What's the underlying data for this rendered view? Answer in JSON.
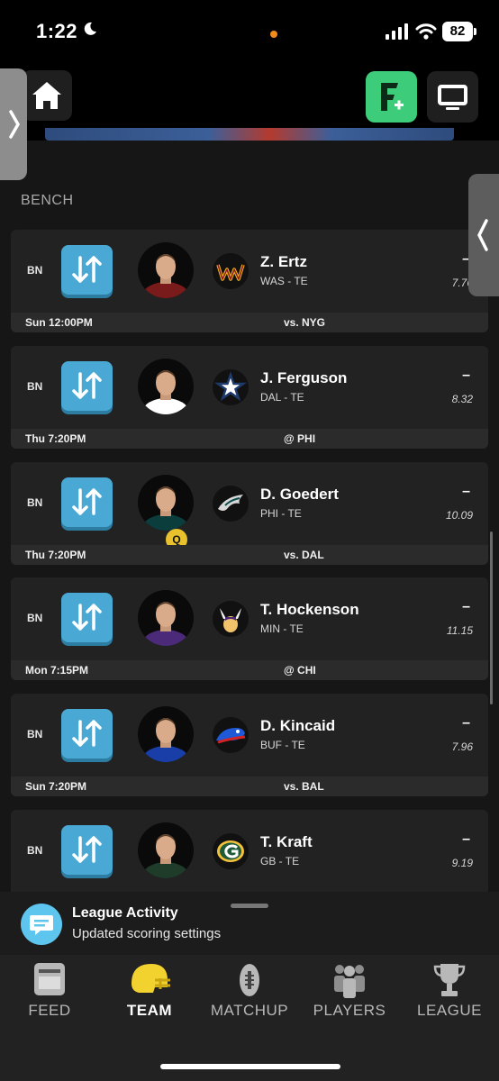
{
  "status": {
    "time": "1:22",
    "battery": "82"
  },
  "header": {
    "home_icon": "home-icon",
    "fantasy_plus_icon": "fantasy-plus-icon",
    "tv_icon": "tv-icon"
  },
  "bench": {
    "title": "BENCH",
    "players": [
      {
        "slot": "BN",
        "name": "Z. Ertz",
        "team_pos": "WAS - TE",
        "points": "–",
        "projection": "7.76",
        "game_time": "Sun 12:00PM",
        "opponent": "vs. NYG",
        "team_color": "#7a1b1b",
        "logo": "commanders-logo"
      },
      {
        "slot": "BN",
        "name": "J. Ferguson",
        "team_pos": "DAL - TE",
        "points": "–",
        "projection": "8.32",
        "game_time": "Thu 7:20PM",
        "opponent": "@ PHI",
        "team_color": "#ffffff",
        "logo": "cowboys-logo"
      },
      {
        "slot": "BN",
        "name": "D. Goedert",
        "team_pos": "PHI - TE",
        "points": "–",
        "projection": "10.09",
        "game_time": "Thu 7:20PM",
        "opponent": "vs. DAL",
        "team_color": "#0b3d3d",
        "logo": "eagles-logo",
        "status": "Q"
      },
      {
        "slot": "BN",
        "name": "T. Hockenson",
        "team_pos": "MIN - TE",
        "points": "–",
        "projection": "11.15",
        "game_time": "Mon 7:15PM",
        "opponent": "@ CHI",
        "team_color": "#4b2a7a",
        "logo": "vikings-logo"
      },
      {
        "slot": "BN",
        "name": "D. Kincaid",
        "team_pos": "BUF - TE",
        "points": "–",
        "projection": "7.96",
        "game_time": "Sun 7:20PM",
        "opponent": "vs. BAL",
        "team_color": "#1a3ea8",
        "logo": "bills-logo"
      },
      {
        "slot": "BN",
        "name": "T. Kraft",
        "team_pos": "GB - TE",
        "points": "–",
        "projection": "9.19",
        "game_time": "",
        "opponent": "",
        "team_color": "#1f3b2a",
        "logo": "packers-logo"
      }
    ]
  },
  "activity": {
    "title": "League Activity",
    "subtitle": "Updated scoring settings"
  },
  "tabs": [
    {
      "label": "FEED",
      "icon": "feed-icon"
    },
    {
      "label": "TEAM",
      "icon": "helmet-icon",
      "active": true
    },
    {
      "label": "MATCHUP",
      "icon": "football-icon"
    },
    {
      "label": "PLAYERS",
      "icon": "players-icon"
    },
    {
      "label": "LEAGUE",
      "icon": "trophy-icon"
    }
  ]
}
